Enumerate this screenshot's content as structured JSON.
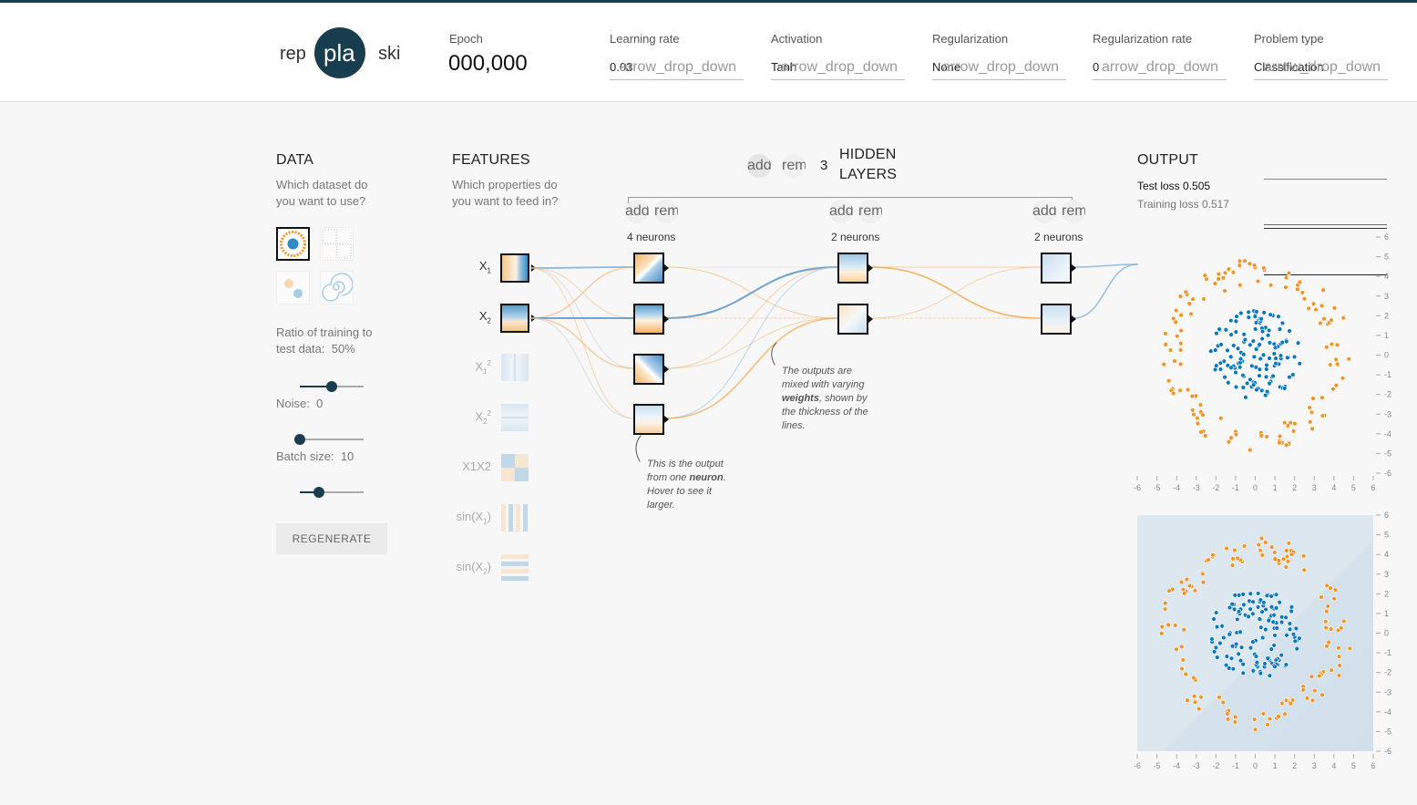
{
  "header": {
    "logo": {
      "left": "rep",
      "center": "pla",
      "right": "ski"
    },
    "epoch": {
      "label": "Epoch",
      "value": "000,000"
    },
    "controls": [
      {
        "label": "Learning rate",
        "value": "0.03",
        "icon": "arrow_drop_down"
      },
      {
        "label": "Activation",
        "value": "Tanh",
        "icon": "arrow_drop_down"
      },
      {
        "label": "Regularization",
        "value": "None",
        "icon": "arrow_drop_down"
      },
      {
        "label": "Regularization rate",
        "value": "0",
        "icon": "arrow_drop_down"
      },
      {
        "label": "Problem type",
        "value": "Classification",
        "icon": "arrow_drop_down"
      }
    ]
  },
  "data_panel": {
    "title": "DATA",
    "question": "Which dataset do you want to use?",
    "ratio_label": "Ratio of training to test data:",
    "ratio_value": "50%",
    "ratio_fraction": 0.5,
    "noise_label": "Noise:",
    "noise_value": "0",
    "noise_fraction": 0.0,
    "batch_label": "Batch size:",
    "batch_value": "10",
    "batch_fraction": 0.3,
    "regenerate_label": "REGENERATE",
    "datasets": [
      "circle",
      "xor",
      "gaussian",
      "spiral"
    ],
    "selected_dataset": "circle"
  },
  "features_panel": {
    "title": "FEATURES",
    "question": "Which properties do you want to feed in?",
    "features": [
      {
        "label": "X",
        "sub": "1",
        "sup": "",
        "active": true
      },
      {
        "label": "X",
        "sub": "2",
        "sup": "",
        "active": true
      },
      {
        "label": "X",
        "sub": "1",
        "sup": "2",
        "active": false
      },
      {
        "label": "X",
        "sub": "2",
        "sup": "2",
        "active": false
      },
      {
        "label": "X1X2",
        "sub": "",
        "sup": "",
        "active": false
      },
      {
        "label": "sin(X",
        "sub": "1",
        "sup": ")",
        "active": false
      },
      {
        "label": "sin(X",
        "sub": "2",
        "sup": ")",
        "active": false
      }
    ]
  },
  "hidden_layers": {
    "add_icon": "add",
    "remove_icon": "remove",
    "count": "3",
    "title_line1": "HIDDEN",
    "title_line2": "LAYERS",
    "layers": [
      {
        "neurons_label": "4 neurons"
      },
      {
        "neurons_label": "2 neurons"
      },
      {
        "neurons_label": "2 neurons"
      }
    ],
    "annotation_neuron": {
      "pre": "This is the output from one ",
      "bold": "neuron",
      "post": ". Hover to see it larger."
    },
    "annotation_weights": {
      "pre": "The outputs are mixed with varying ",
      "bold": "weights",
      "post": ", shown by the thickness of the lines."
    }
  },
  "output_panel": {
    "title": "OUTPUT",
    "test_loss_label": "Test loss",
    "test_loss_value": "0.505",
    "train_loss_label": "Training loss",
    "train_loss_value": "0.517",
    "axis_ticks": [
      "-6",
      "-5",
      "-4",
      "-3",
      "-2",
      "-1",
      "0",
      "1",
      "2",
      "3",
      "4",
      "5",
      "6"
    ]
  },
  "colors": {
    "orange": "#f59322",
    "blue": "#0877bd",
    "dark": "#183d4e"
  }
}
